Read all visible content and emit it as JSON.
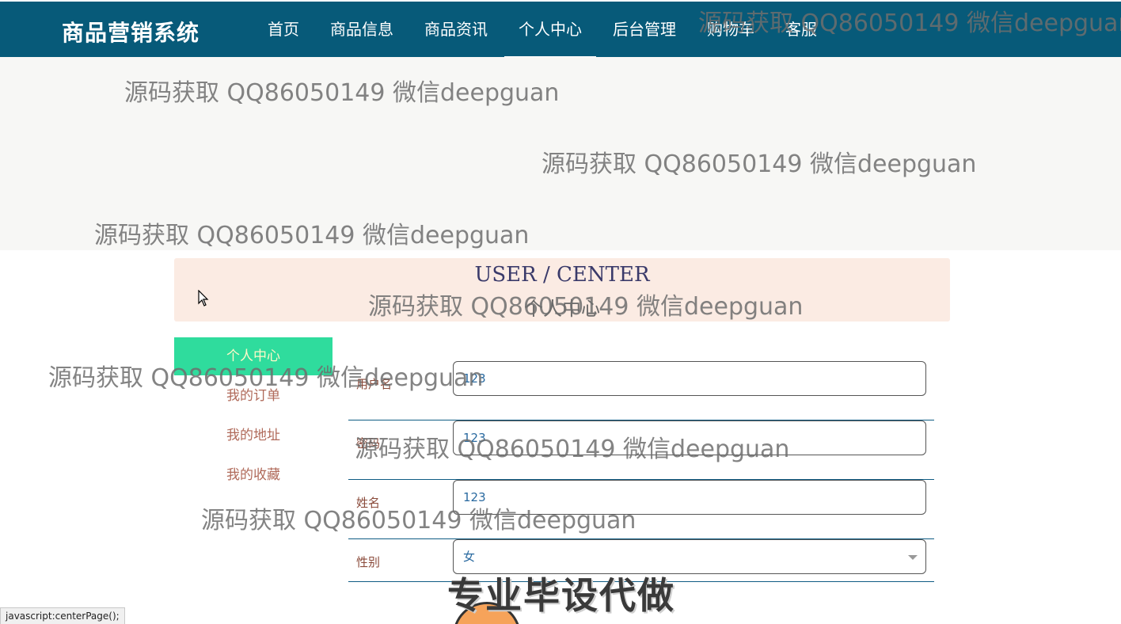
{
  "header": {
    "brand": "商品营销系统",
    "nav": [
      "首页",
      "商品信息",
      "商品资讯",
      "个人中心",
      "后台管理",
      "购物车",
      "客服"
    ],
    "active_nav": "个人中心"
  },
  "watermark": "源码获取 QQ86050149 微信deepguan",
  "page_title": {
    "en": "USER / CENTER",
    "cn": "个人中心"
  },
  "sidebar": {
    "items": [
      {
        "label": "个人中心"
      },
      {
        "label": "我的订单"
      },
      {
        "label": "我的地址"
      },
      {
        "label": "我的收藏"
      }
    ]
  },
  "form": {
    "fields": [
      {
        "label": "用户名",
        "value": "123"
      },
      {
        "label": "密码",
        "value": "123"
      },
      {
        "label": "姓名",
        "value": "123"
      },
      {
        "label": "性别",
        "value": "女"
      }
    ]
  },
  "promo": "专业毕设代做",
  "status_bar": "javascript:centerPage();",
  "colors": {
    "header_bg": "#075a79",
    "active_side": "#2fdc9d",
    "title_bg": "#fbebe3"
  }
}
